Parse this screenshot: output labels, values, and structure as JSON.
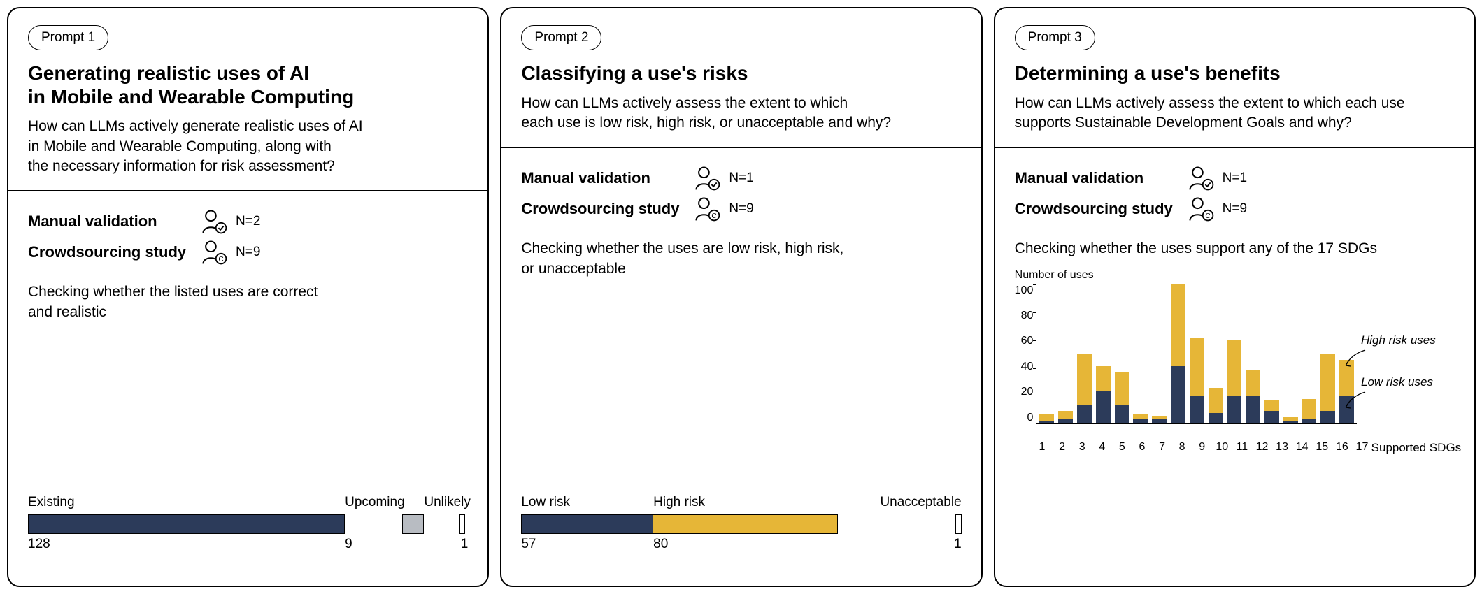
{
  "panels": [
    {
      "badge": "Prompt 1",
      "title": "Generating realistic uses of AI\nin Mobile and Wearable Computing",
      "desc": "How can LLMs actively generate realistic uses of AI\nin Mobile and Wearable Computing, along with\nthe necessary information for risk assessment?",
      "manual_label": "Manual validation",
      "manual_n": "N=2",
      "crowd_label": "Crowdsourcing study",
      "crowd_n": "N=9",
      "check": "Checking whether the listed uses are correct\nand realistic"
    },
    {
      "badge": "Prompt 2",
      "title": "Classifying a use's risks",
      "desc": "How can LLMs actively assess the extent to which\neach use is low risk, high risk, or unacceptable and why?",
      "manual_label": "Manual validation",
      "manual_n": "N=1",
      "crowd_label": "Crowdsourcing study",
      "crowd_n": "N=9",
      "check": "Checking whether the uses are low risk, high risk,\nor unacceptable"
    },
    {
      "badge": "Prompt 3",
      "title": "Determining a use's benefits",
      "desc": "How can LLMs actively assess the extent to which each use\nsupports Sustainable Development Goals and why?",
      "manual_label": "Manual validation",
      "manual_n": "N=1",
      "crowd_label": "Crowdsourcing study",
      "crowd_n": "N=9",
      "check": "Checking whether the uses support any of the 17 SDGs"
    }
  ],
  "chart_data": [
    {
      "type": "bar",
      "title": "",
      "categories": [
        "Existing",
        "Upcoming",
        "Unlikely"
      ],
      "values": [
        128,
        9,
        1
      ],
      "colors": [
        "#2c3b5a",
        "#b8bcc2",
        "#ffffff"
      ]
    },
    {
      "type": "bar",
      "title": "",
      "categories": [
        "Low risk",
        "High risk",
        "Unacceptable"
      ],
      "values": [
        57,
        80,
        1
      ],
      "colors": [
        "#2c3b5a",
        "#e6b637",
        "#ffffff"
      ]
    },
    {
      "type": "bar",
      "stacked": true,
      "title": "Number of uses",
      "xlabel": "Supported SDGs",
      "ylabel": "Number of uses",
      "ylim": [
        0,
        100
      ],
      "yticks": [
        0,
        20,
        40,
        60,
        80,
        100
      ],
      "categories": [
        "1",
        "2",
        "3",
        "4",
        "5",
        "6",
        "7",
        "8",
        "9",
        "10",
        "11",
        "12",
        "13",
        "14",
        "15",
        "16",
        "17"
      ],
      "series": [
        {
          "name": "Low risk uses",
          "color": "#2c3b5a",
          "values": [
            2,
            3,
            15,
            25,
            14,
            3,
            3,
            45,
            22,
            8,
            22,
            22,
            10,
            2,
            3,
            10,
            22
          ]
        },
        {
          "name": "High risk uses",
          "color": "#e6b637",
          "values": [
            5,
            7,
            40,
            20,
            26,
            4,
            3,
            65,
            45,
            20,
            44,
            20,
            8,
            3,
            16,
            45,
            28
          ]
        }
      ],
      "annotations": [
        "High risk uses",
        "Low risk uses"
      ]
    }
  ],
  "colors": {
    "navy": "#2c3b5a",
    "yellow": "#e6b637",
    "grey": "#b8bcc2"
  }
}
